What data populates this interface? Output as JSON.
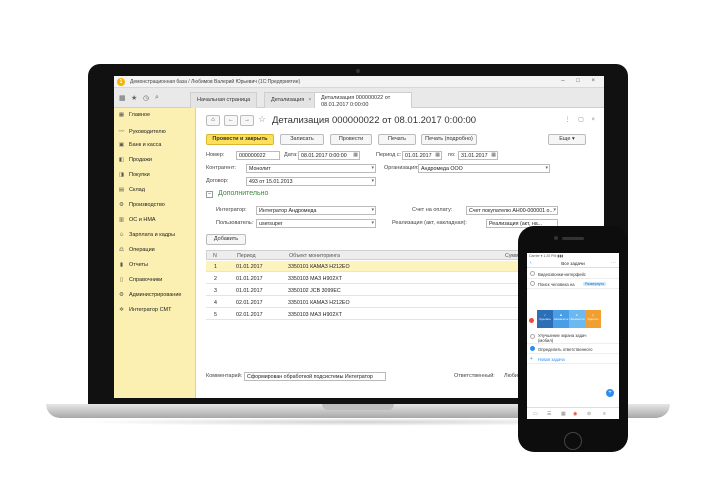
{
  "window": {
    "title": "Демонстрационная база / Любимов Валерий Юрьевич (1С:Предприятие)",
    "controls": "– □ ×"
  },
  "tabs": [
    {
      "label": "Начальная страница"
    },
    {
      "label": "Детализация"
    },
    {
      "label": "Детализация 000000022 от 08.01.2017 0:00:00"
    }
  ],
  "sidebar": {
    "items": [
      {
        "label": "Главное",
        "icon": "grid-icon"
      },
      {
        "label": "Руководителю",
        "icon": "chart-line-icon"
      },
      {
        "label": "Банк и касса",
        "icon": "bank-icon"
      },
      {
        "label": "Продажи",
        "icon": "sales-icon"
      },
      {
        "label": "Покупки",
        "icon": "purchases-icon"
      },
      {
        "label": "Склад",
        "icon": "warehouse-icon"
      },
      {
        "label": "Производство",
        "icon": "production-icon"
      },
      {
        "label": "ОС и НМА",
        "icon": "assets-icon"
      },
      {
        "label": "Зарплата и кадры",
        "icon": "people-icon"
      },
      {
        "label": "Операции",
        "icon": "operations-icon"
      },
      {
        "label": "Отчеты",
        "icon": "reports-icon"
      },
      {
        "label": "Справочники",
        "icon": "books-icon"
      },
      {
        "label": "Администрирование",
        "icon": "gear-icon"
      },
      {
        "label": "Интегратор СМТ",
        "icon": "integrator-icon"
      }
    ]
  },
  "document": {
    "title": "Детализация 000000022 от 08.01.2017 0:00:00",
    "buttons": {
      "post_close": "Провести и закрыть",
      "save": "Записать",
      "post": "Провести",
      "print": "Печать",
      "print_detailed": "Печать (подробно)",
      "more": "Еще"
    },
    "fields": {
      "number_label": "Номер:",
      "number": "000000022",
      "date_label": "Дата:",
      "date": "08.01.2017  0:00:00",
      "period_from_label": "Период с:",
      "period_from": "01.01.2017",
      "period_to_label": "по:",
      "period_to": "31.01.2017",
      "counterparty_label": "Контрагент:",
      "counterparty": "Монолит",
      "organization_label": "Организация:",
      "organization": "Андромеда ООО",
      "contract_label": "Договор:",
      "contract": "493 от 15.01.2013",
      "integrator_label": "Интегратор:",
      "integrator": "Интегратор Андромеда",
      "user_label": "Пользователь:",
      "user": "usersuper",
      "invoice_label": "Счет на оплату:",
      "invoice": "Счет покупателю АН00-000001 о...",
      "sale_label": "Реализация (акт, накладная):",
      "sale": "Реализация (акт, на...",
      "comment_label": "Комментарий:",
      "comment": "Сформирован обработкой подсистемы Интегратор",
      "responsible_label": "Ответственный:",
      "responsible": "Любимов В..."
    },
    "section_label": "Дополнительно",
    "add_button": "Добавить",
    "table": {
      "columns": [
        "N",
        "Период",
        "Объект мониторинга",
        "Сумма"
      ],
      "rows": [
        {
          "n": "1",
          "period": "01.01.2017",
          "object": "3350101 КАМАЗ Н212ЕО"
        },
        {
          "n": "2",
          "period": "01.01.2017",
          "object": "3350103 МАЗ Н902ХТ"
        },
        {
          "n": "3",
          "period": "01.01.2017",
          "object": "3350102 JCB 3099ЕС"
        },
        {
          "n": "4",
          "period": "02.01.2017",
          "object": "3350101 КАМАЗ Н212ЕО"
        },
        {
          "n": "5",
          "period": "02.01.2017",
          "object": "3350103 МАЗ Н902ХТ"
        }
      ]
    }
  },
  "phone": {
    "status": "Carrier  ▾   1:20 PM   ▮▮▮",
    "header_title": "Все задачи",
    "tasks": [
      {
        "text": "Видеозвонки-интерфейс",
        "done": false
      },
      {
        "text": "Поиск человека на",
        "tag": "Развернуто",
        "done": false
      },
      {
        "text": "Улучшение экрана задач (мобил)",
        "done": false
      },
      {
        "text": "Определить ответственного",
        "done": true
      }
    ],
    "new_task": "Новая задача",
    "actions": [
      "Сделать",
      "Назначить",
      "Перенести",
      "Удалить"
    ],
    "action_colors": [
      "#2d6fb7",
      "#4a9ee8",
      "#6bb9f0",
      "#f0a030"
    ]
  }
}
